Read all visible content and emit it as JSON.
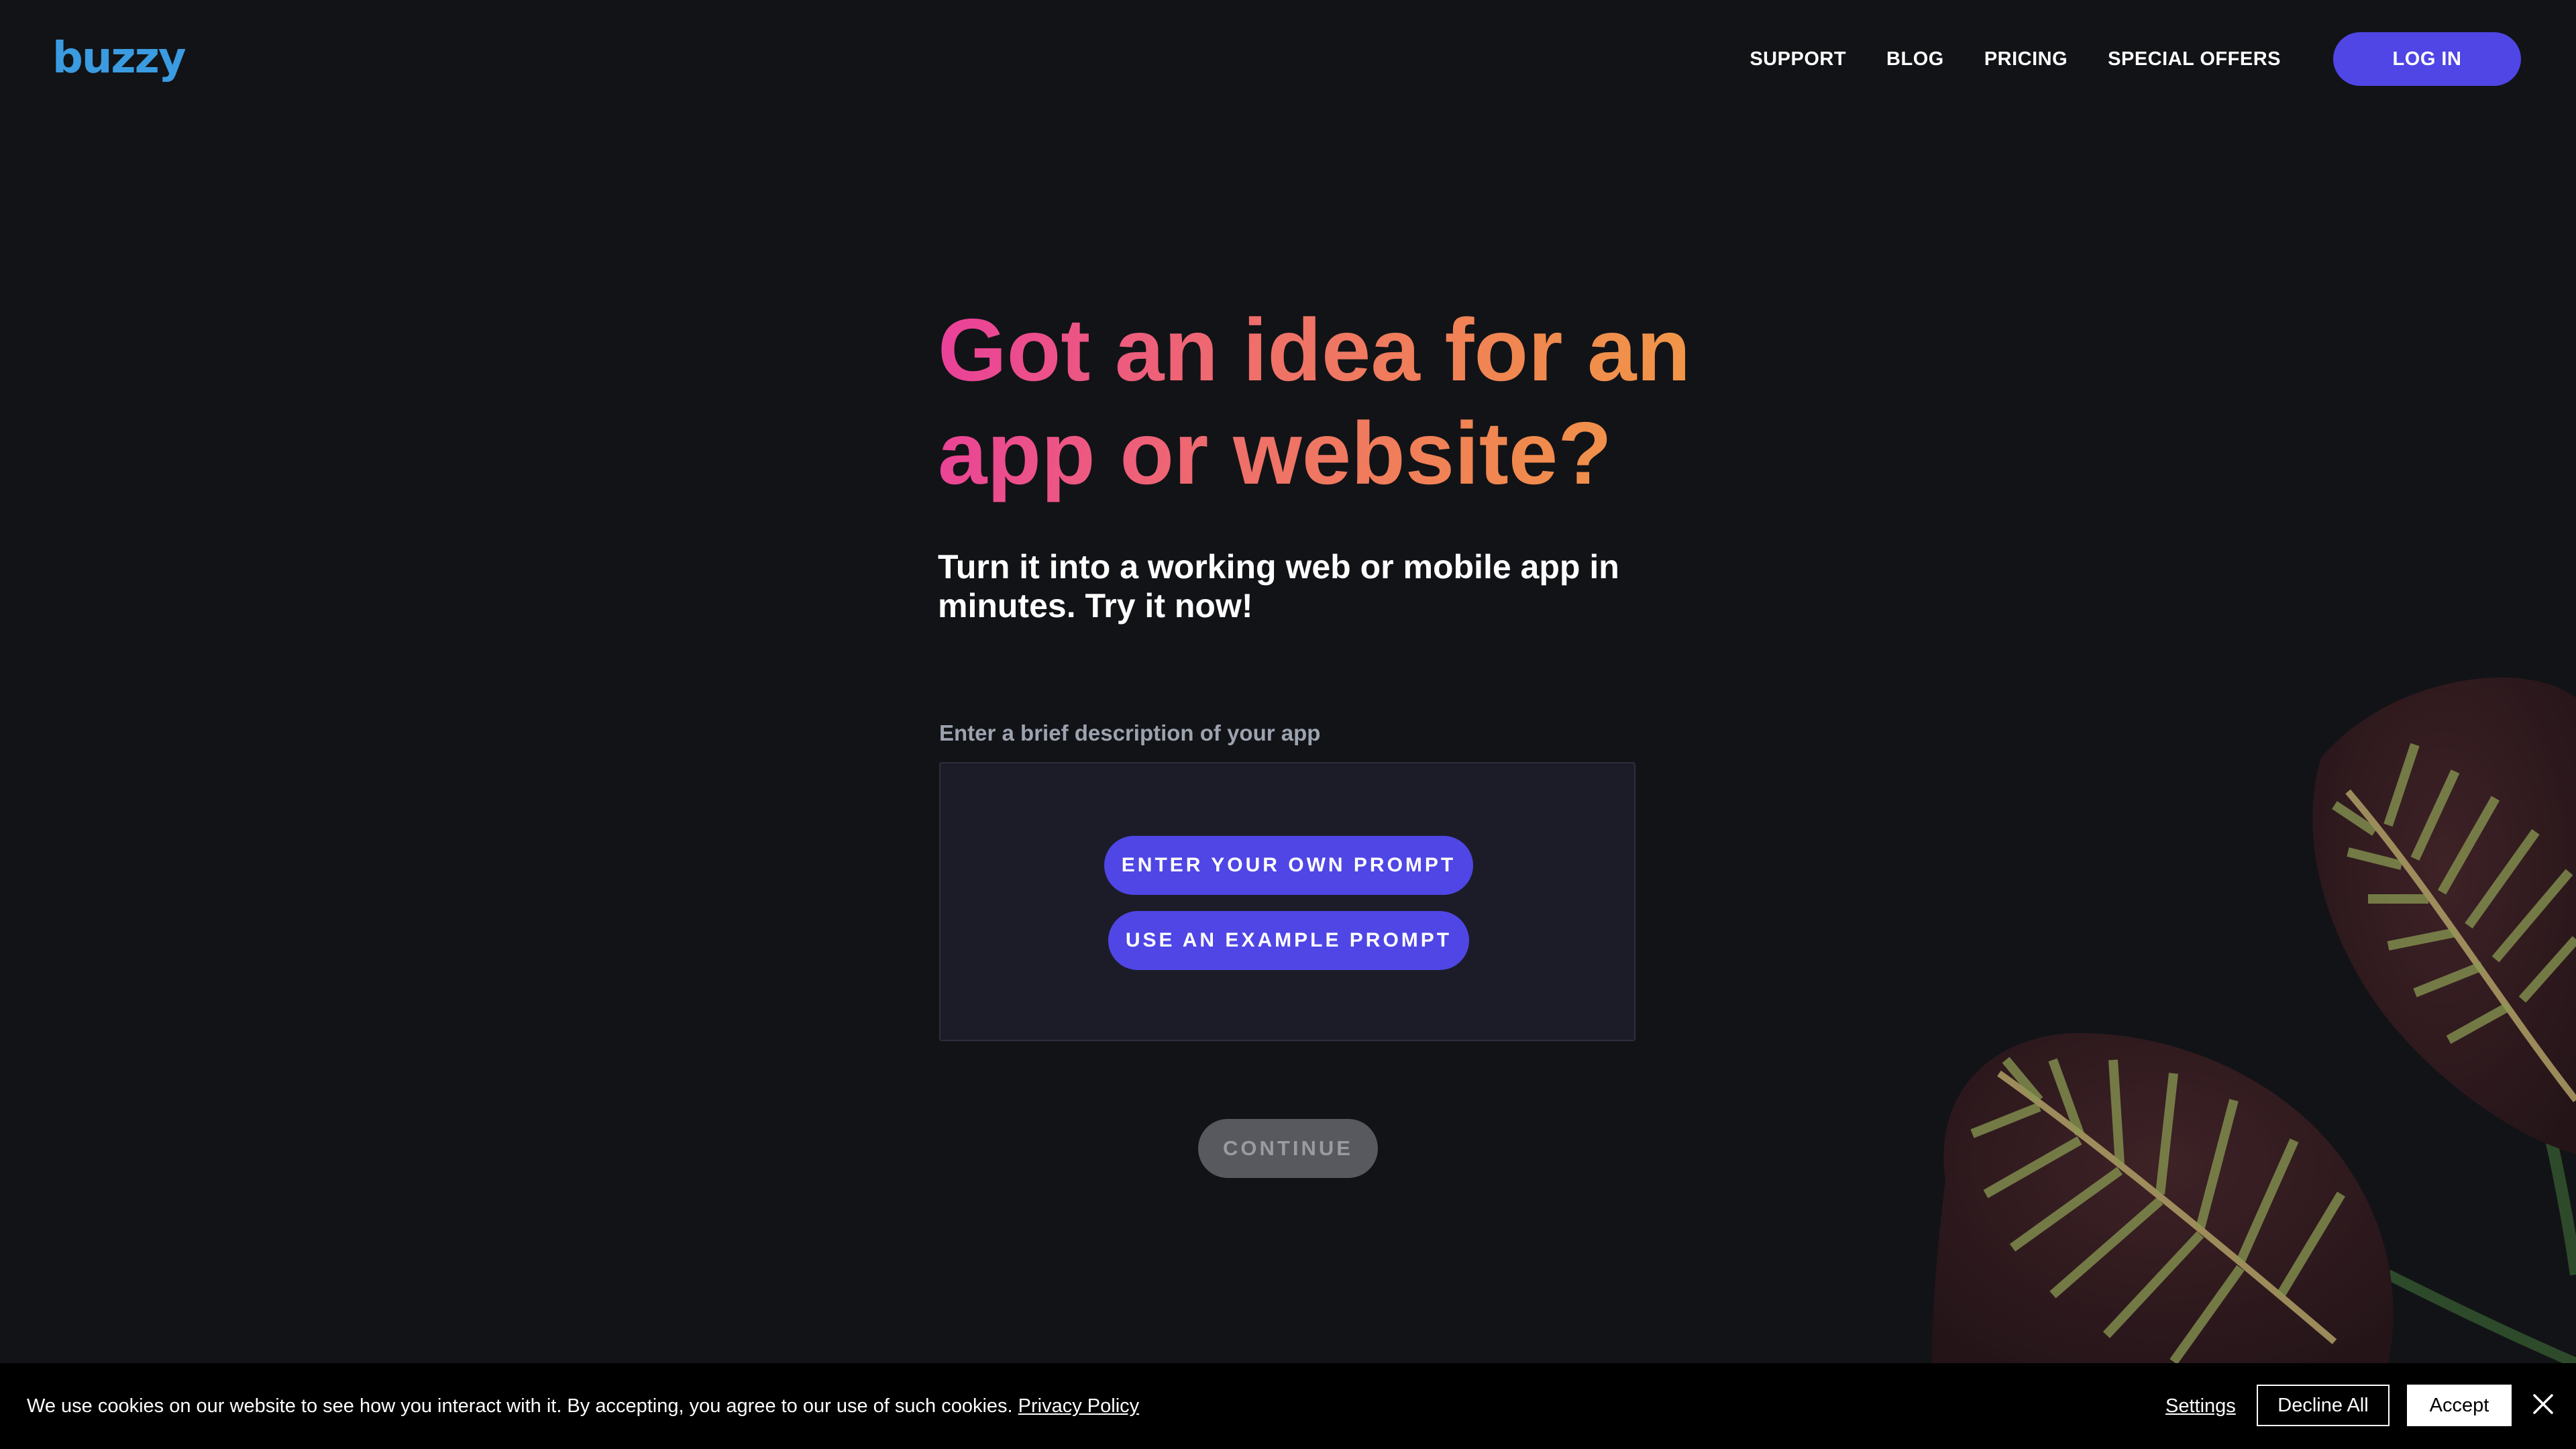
{
  "header": {
    "logo_text": "buzzy",
    "nav": [
      "SUPPORT",
      "BLOG",
      "PRICING",
      "SPECIAL OFFERS"
    ],
    "login_label": "LOG IN"
  },
  "hero": {
    "title_line1": "Got an idea for an",
    "title_line2": "app or website?",
    "subtitle_line1": "Turn it into a working web or mobile app in",
    "subtitle_line2": "minutes. Try it now!"
  },
  "form": {
    "label": "Enter a brief description of your app",
    "own_prompt_label": "ENTER YOUR OWN PROMPT",
    "example_prompt_label": "USE AN EXAMPLE PROMPT",
    "continue_label": "CONTINUE"
  },
  "cookie": {
    "text": "We use cookies on our website to see how you interact with it. By accepting, you agree to our use of such cookies.",
    "privacy_link": "Privacy Policy",
    "settings_label": "Settings",
    "decline_label": "Decline All",
    "accept_label": "Accept",
    "close_icon": "close-icon"
  },
  "colors": {
    "background": "#121317",
    "accent": "#4f46e5",
    "logo": "#3a9be0",
    "gradient_start": "#ea3f9b",
    "gradient_end": "#f19a47",
    "disabled_button": "#58595e"
  },
  "decoration": {
    "image": "calathea-plant-leaves"
  }
}
